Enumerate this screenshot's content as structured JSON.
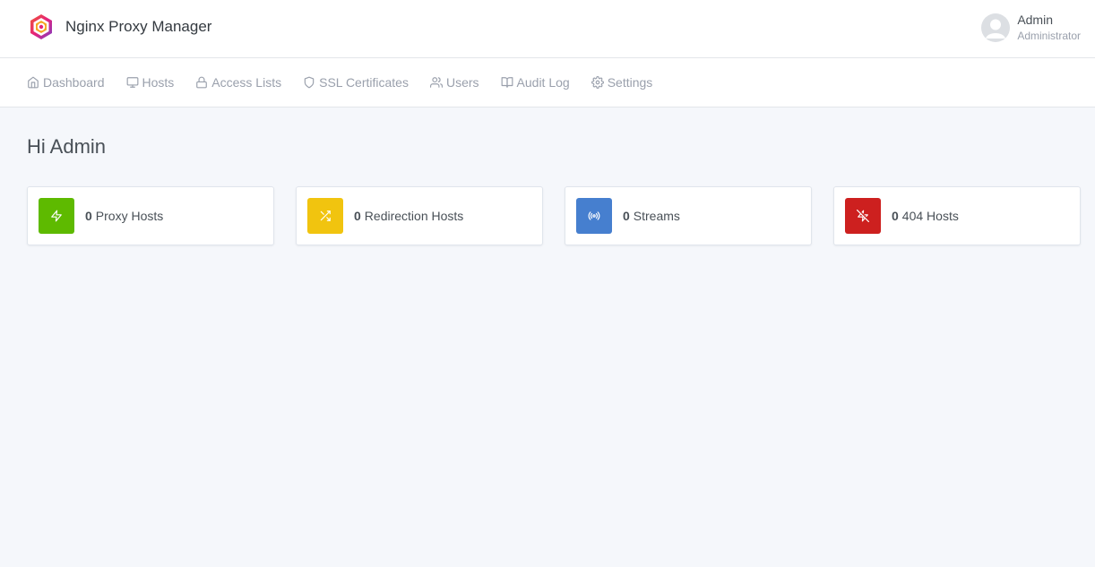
{
  "header": {
    "app_name": "Nginx Proxy Manager",
    "logo_icon": "nginx-proxy-manager-logo",
    "user": {
      "name": "Admin",
      "role": "Administrator",
      "avatar_icon": "user-avatar-icon"
    }
  },
  "nav": {
    "items": [
      {
        "label": "Dashboard",
        "icon": "home-icon"
      },
      {
        "label": "Hosts",
        "icon": "monitor-icon"
      },
      {
        "label": "Access Lists",
        "icon": "lock-icon"
      },
      {
        "label": "SSL Certificates",
        "icon": "shield-icon"
      },
      {
        "label": "Users",
        "icon": "users-icon"
      },
      {
        "label": "Audit Log",
        "icon": "book-open-icon"
      },
      {
        "label": "Settings",
        "icon": "settings-icon"
      }
    ]
  },
  "main": {
    "greeting": "Hi Admin",
    "cards": [
      {
        "count": "0",
        "label": "Proxy Hosts",
        "icon": "zap-icon",
        "color": "#5eba00"
      },
      {
        "count": "0",
        "label": "Redirection Hosts",
        "icon": "shuffle-icon",
        "color": "#f1c40f"
      },
      {
        "count": "0",
        "label": "Streams",
        "icon": "radio-icon",
        "color": "#467fcf"
      },
      {
        "count": "0",
        "label": "404 Hosts",
        "icon": "zap-off-icon",
        "color": "#cd201f"
      }
    ]
  }
}
